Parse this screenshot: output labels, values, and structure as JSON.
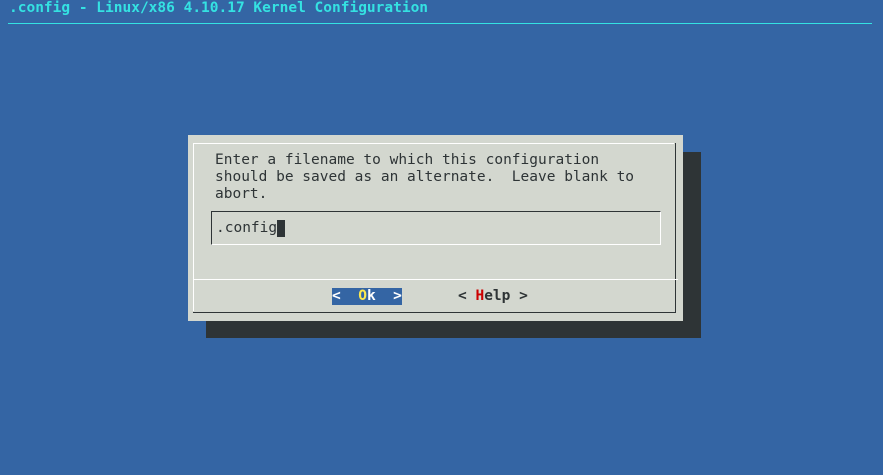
{
  "window": {
    "title": ".config - Linux/x86 4.10.17 Kernel Configuration"
  },
  "dialog": {
    "prompt_lines": [
      "Enter a filename to which this configuration",
      "should be saved as an alternate.  Leave blank to",
      "abort."
    ],
    "input_value": ".config",
    "buttons": {
      "ok": {
        "left": "<  ",
        "hotkey": "O",
        "rest": "k  >"
      },
      "help": {
        "left": "< ",
        "hotkey": "H",
        "rest": "elp >"
      }
    }
  },
  "colors": {
    "background": "#3465a4",
    "title": "#34e2e2",
    "dialog": "#d3d7cf",
    "shadow": "#2e3436",
    "hotkey_selected": "#fce94f",
    "hotkey_unselected": "#cc0000"
  }
}
